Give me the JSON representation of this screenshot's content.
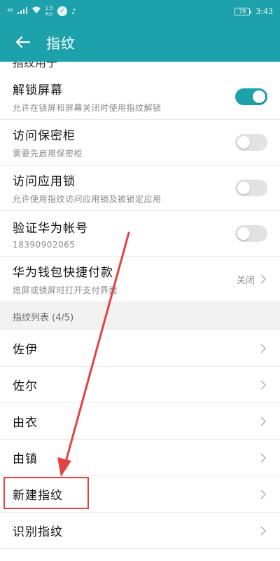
{
  "status_bar": {
    "network": "⁴⁶",
    "speed_value": "2.5",
    "speed_unit": "K/s",
    "battery": "78",
    "time": "3:43"
  },
  "app_bar": {
    "title": "指纹"
  },
  "partial_row": "指纹用于",
  "settings": [
    {
      "title": "解锁屏幕",
      "subtitle": "允许在锁屏和屏幕关闭时使用指纹解锁",
      "toggle": true
    },
    {
      "title": "访问保密柜",
      "subtitle": "需要先启用保密柜",
      "toggle": false
    },
    {
      "title": "访问应用锁",
      "subtitle": "允许使用指纹访问应用锁及被锁定应用",
      "toggle": false
    },
    {
      "title": "验证华为帐号",
      "subtitle": "18390902065",
      "toggle": false
    },
    {
      "title": "华为钱包快捷付款",
      "subtitle": "熄屏或锁屏时打开支付界面",
      "value": "关闭"
    }
  ],
  "section_header": "指纹列表 (4/5)",
  "fingerprints": [
    {
      "label": "佐伊"
    },
    {
      "label": "佐尔"
    },
    {
      "label": "由衣"
    },
    {
      "label": "由镇"
    },
    {
      "label": "新建指纹"
    },
    {
      "label": "识别指纹"
    }
  ],
  "colors": {
    "accent": "#1da1ab",
    "annotation": "#e24242"
  }
}
